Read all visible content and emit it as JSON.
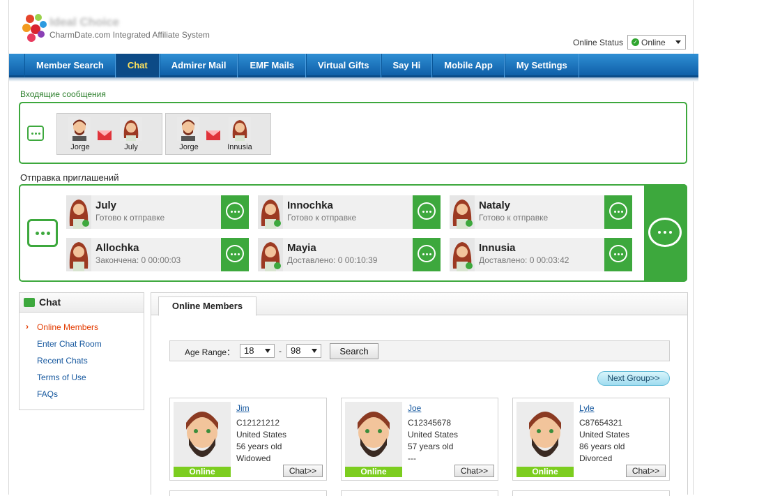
{
  "brand": {
    "title": "Ideal Choice",
    "subtitle": "CharmDate.com Integrated Affiliate System"
  },
  "status": {
    "label": "Online Status",
    "value": "Online"
  },
  "nav": [
    "Member Search",
    "Chat",
    "Admirer Mail",
    "EMF Mails",
    "Virtual Gifts",
    "Say Hi",
    "Mobile App",
    "My Settings"
  ],
  "nav_active": "Chat",
  "incoming": {
    "label": "Входящие сообщения",
    "cards": [
      {
        "from": "Jorge",
        "to": "July"
      },
      {
        "from": "Jorge",
        "to": "Innusia"
      }
    ]
  },
  "invites": {
    "label": "Отправка приглашений",
    "cards": [
      {
        "name": "July",
        "status": "Готово к отправке"
      },
      {
        "name": "Innochka",
        "status": "Готово к отправке"
      },
      {
        "name": "Nataly",
        "status": "Готово к отправке"
      },
      {
        "name": "Allochka",
        "status": "Закончена: 0  00:00:03"
      },
      {
        "name": "Mayia",
        "status": "Доставлено: 0  00:10:39"
      },
      {
        "name": "Innusia",
        "status": "Доставлено: 0  00:03:42"
      }
    ]
  },
  "sidebar": {
    "title": "Chat",
    "items": [
      "Online Members",
      "Enter Chat Room",
      "Recent Chats",
      "Terms of Use",
      "FAQs"
    ],
    "active": "Online Members",
    "arrow": "›"
  },
  "main": {
    "tab": "Online Members",
    "age_label": "Age Range：",
    "age_min": "18",
    "age_max": "98",
    "dash": "-",
    "search_button": "Search",
    "next_group": "Next Group>>",
    "members": [
      {
        "name": "Jim",
        "id": "C12121212",
        "country": "United States",
        "age": "56 years old",
        "marital": "Widowed",
        "badge": "Online",
        "chat": "Chat>>"
      },
      {
        "name": "Joe",
        "id": "C12345678",
        "country": "United States",
        "age": "57 years old",
        "marital": "---",
        "badge": "Online",
        "chat": "Chat>>"
      },
      {
        "name": "Lyle",
        "id": "C87654321",
        "country": "United States",
        "age": "86 years old",
        "marital": "Divorced",
        "badge": "Online",
        "chat": "Chat>>"
      }
    ]
  },
  "colors": {
    "nav": "#1a70bd",
    "green": "#3da83d",
    "online_badge": "#7ccd1f",
    "link": "#15579e",
    "active": "#e33b00"
  }
}
